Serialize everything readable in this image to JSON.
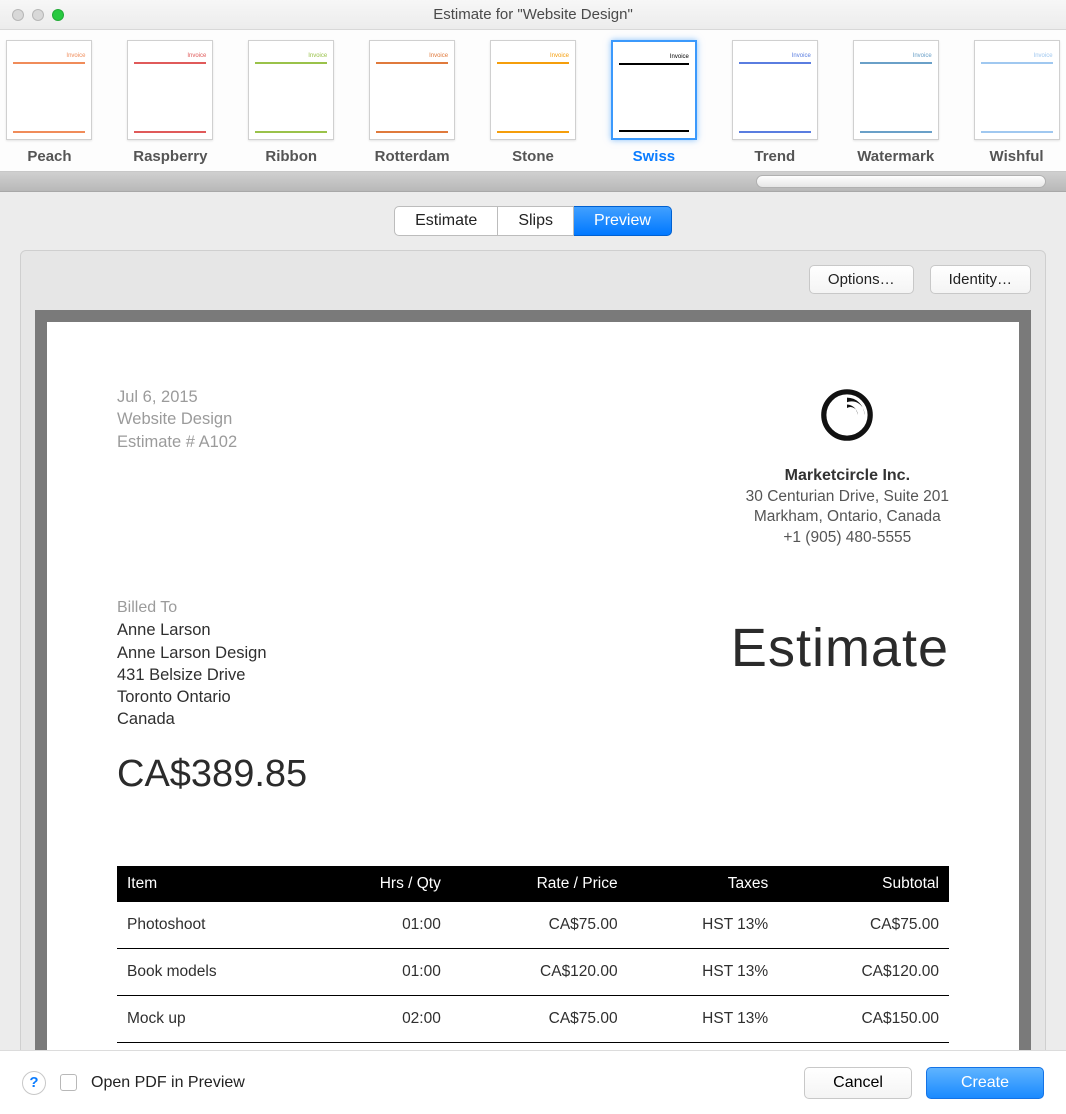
{
  "window": {
    "title": "Estimate for \"Website Design\""
  },
  "templates": [
    {
      "label": "Peach",
      "selected": false,
      "accent": "#f08c5a"
    },
    {
      "label": "Raspberry",
      "selected": false,
      "accent": "#e05a5a"
    },
    {
      "label": "Ribbon",
      "selected": false,
      "accent": "#9ac24a"
    },
    {
      "label": "Rotterdam",
      "selected": false,
      "accent": "#e07a3c"
    },
    {
      "label": "Stone",
      "selected": false,
      "accent": "#f59e0b"
    },
    {
      "label": "Swiss",
      "selected": true,
      "accent": "#000000"
    },
    {
      "label": "Trend",
      "selected": false,
      "accent": "#5a7de0"
    },
    {
      "label": "Watermark",
      "selected": false,
      "accent": "#6aa0c8"
    },
    {
      "label": "Wishful",
      "selected": false,
      "accent": "#a0c8f0"
    }
  ],
  "segments": {
    "estimate": "Estimate",
    "slips": "Slips",
    "preview": "Preview",
    "active": "preview"
  },
  "actions": {
    "options": "Options…",
    "identity": "Identity…"
  },
  "doc": {
    "date": "Jul 6, 2015",
    "project": "Website Design",
    "number": "Estimate # A102",
    "company": {
      "name": "Marketcircle Inc.",
      "line1": "30 Centurian Drive, Suite 201",
      "line2": "Markham, Ontario, Canada",
      "phone": "+1 (905) 480-5555"
    },
    "billto_label": "Billed To",
    "billto": {
      "name": "Anne Larson",
      "company": "Anne Larson Design",
      "street": "431 Belsize Drive",
      "city": "Toronto Ontario",
      "country": "Canada"
    },
    "title": "Estimate",
    "total": "CA$389.85",
    "columns": {
      "item": "Item",
      "qty": "Hrs / Qty",
      "rate": "Rate / Price",
      "taxes": "Taxes",
      "subtotal": "Subtotal"
    },
    "items": [
      {
        "item": "Photoshoot",
        "qty": "01:00",
        "rate": "CA$75.00",
        "taxes": "HST 13%",
        "subtotal": "CA$75.00"
      },
      {
        "item": "Book models",
        "qty": "01:00",
        "rate": "CA$120.00",
        "taxes": "HST 13%",
        "subtotal": "CA$120.00"
      },
      {
        "item": "Mock up",
        "qty": "02:00",
        "rate": "CA$75.00",
        "taxes": "HST 13%",
        "subtotal": "CA$150.00"
      }
    ]
  },
  "footer": {
    "open_pdf_label": "Open PDF in Preview",
    "cancel": "Cancel",
    "create": "Create"
  }
}
